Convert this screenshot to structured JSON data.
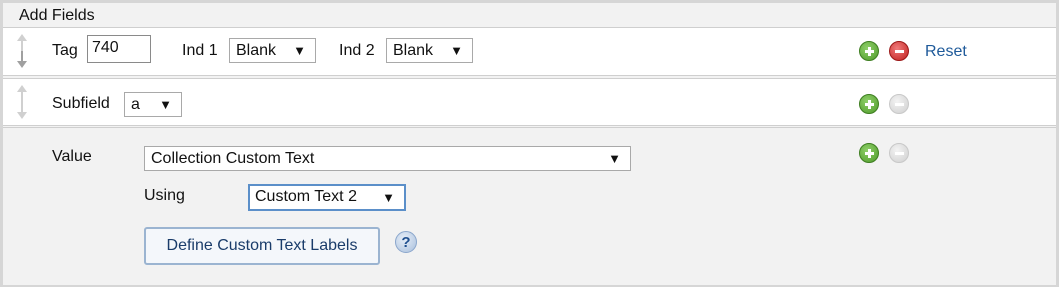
{
  "header": {
    "title": "Add Fields"
  },
  "row_tag": {
    "tag_label": "Tag",
    "tag_value": "740",
    "ind1_label": "Ind 1",
    "ind1_value": "Blank",
    "ind2_label": "Ind 2",
    "ind2_value": "Blank",
    "reset_label": "Reset"
  },
  "row_subfield": {
    "label": "Subfield",
    "value": "a"
  },
  "row_value": {
    "label": "Value",
    "value_select": "Collection Custom Text",
    "using_label": "Using",
    "using_select": "Custom Text 2",
    "define_button": "Define Custom Text Labels",
    "help_symbol": "?"
  },
  "icons": {
    "dropdown": "dropdown-arrow-icon",
    "add": "add-circle-icon",
    "remove": "remove-circle-icon",
    "drag": "drag-handle-icon",
    "help": "help-icon"
  },
  "colors": {
    "link": "#1f5a9a",
    "add_green": "#4f9a2a",
    "remove_red": "#c0201e",
    "focus_border": "#5b8fc9"
  },
  "glyphs": {
    "arrow": "▼"
  }
}
